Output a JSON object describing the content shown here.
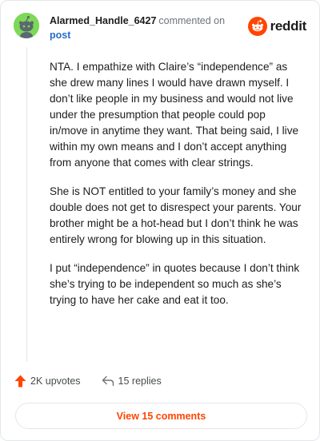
{
  "header": {
    "username": "Alarmed_Handle_6427",
    "action": "commented on",
    "link": "post",
    "brand": "reddit",
    "brand_icon": "reddit-snoo-icon",
    "avatar_icon": "snoo-avatar-icon"
  },
  "comment": {
    "paragraphs": [
      "NTA. I empathize with Claire’s “independence” as she drew many lines I would have drawn myself. I don’t like people in my business and would not live under the presumption that people could pop in/move in anytime they want. That being said, I live within my own means and I don’t accept anything from anyone that comes with clear strings.",
      "She is NOT entitled to your family’s money and she double does not get to disrespect your parents. Your brother might be a hot-head but I don’t think he was entirely wrong for blowing up in this situation.",
      "I put “independence” in quotes because I don’t think she’s trying to be independent so much as she’s trying to have her cake and eat it too."
    ]
  },
  "footer": {
    "upvotes": "2K upvotes",
    "upvote_icon": "upvote-arrow-icon",
    "replies": "15 replies",
    "reply_icon": "reply-arrow-icon",
    "view_comments": "View 15 comments"
  },
  "colors": {
    "accent": "#ff4500",
    "avatar_bg": "#7dd957",
    "link": "#2a6cc9"
  }
}
